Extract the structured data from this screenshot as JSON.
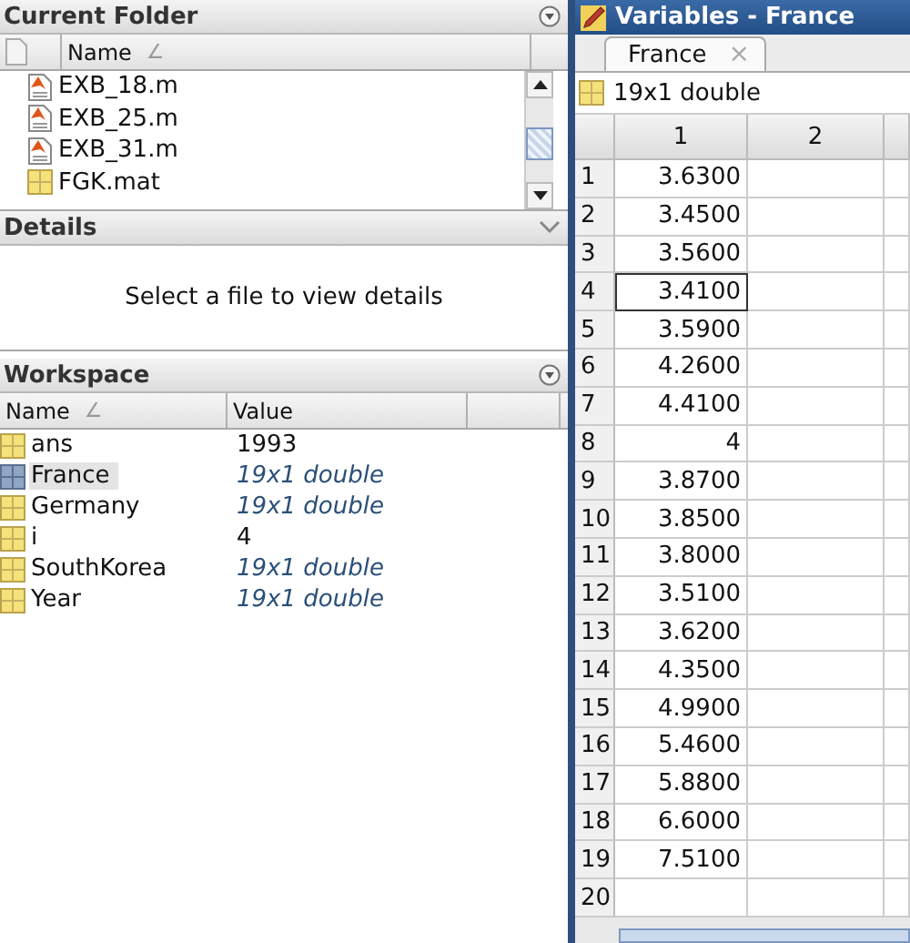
{
  "current_folder": {
    "title": "Current Folder",
    "column": "Name",
    "sort_mark": "∠",
    "files": [
      {
        "name": "EXB_18.m",
        "kind": "script"
      },
      {
        "name": "EXB_25.m",
        "kind": "script"
      },
      {
        "name": "EXB_31.m",
        "kind": "script"
      },
      {
        "name": "FGK.mat",
        "kind": "data"
      }
    ]
  },
  "details": {
    "title": "Details",
    "message": "Select a file to view details"
  },
  "workspace": {
    "title": "Workspace",
    "columns": [
      "Name",
      "Value"
    ],
    "sort_mark": "∠",
    "rows": [
      {
        "name": "ans",
        "value": "1993",
        "kind": "scalar",
        "selected": false
      },
      {
        "name": "France",
        "value": "19x1 double",
        "kind": "array",
        "selected": true
      },
      {
        "name": "Germany",
        "value": "19x1 double",
        "kind": "array",
        "selected": false
      },
      {
        "name": "i",
        "value": "4",
        "kind": "scalar",
        "selected": false
      },
      {
        "name": "SouthKorea",
        "value": "19x1 double",
        "kind": "array",
        "selected": false
      },
      {
        "name": "Year",
        "value": "19x1 double",
        "kind": "array",
        "selected": false
      }
    ]
  },
  "variables": {
    "title": "Variables - France",
    "tab": {
      "label": "France",
      "close": "×"
    },
    "info": "19x1 double",
    "columns": [
      "1",
      "2"
    ],
    "rows": [
      {
        "index": "1",
        "value": "3.6300",
        "selected": false
      },
      {
        "index": "2",
        "value": "3.4500",
        "selected": false
      },
      {
        "index": "3",
        "value": "3.5600",
        "selected": false
      },
      {
        "index": "4",
        "value": "3.4100",
        "selected": true
      },
      {
        "index": "5",
        "value": "3.5900",
        "selected": false
      },
      {
        "index": "6",
        "value": "4.2600",
        "selected": false
      },
      {
        "index": "7",
        "value": "4.4100",
        "selected": false
      },
      {
        "index": "8",
        "value": "4",
        "selected": false
      },
      {
        "index": "9",
        "value": "3.8700",
        "selected": false
      },
      {
        "index": "10",
        "value": "3.8500",
        "selected": false
      },
      {
        "index": "11",
        "value": "3.8000",
        "selected": false
      },
      {
        "index": "12",
        "value": "3.5100",
        "selected": false
      },
      {
        "index": "13",
        "value": "3.6200",
        "selected": false
      },
      {
        "index": "14",
        "value": "4.3500",
        "selected": false
      },
      {
        "index": "15",
        "value": "4.9900",
        "selected": false
      },
      {
        "index": "16",
        "value": "5.4600",
        "selected": false
      },
      {
        "index": "17",
        "value": "5.8800",
        "selected": false
      },
      {
        "index": "18",
        "value": "6.6000",
        "selected": false
      },
      {
        "index": "19",
        "value": "7.5100",
        "selected": false
      },
      {
        "index": "20",
        "value": "",
        "selected": false
      }
    ]
  }
}
